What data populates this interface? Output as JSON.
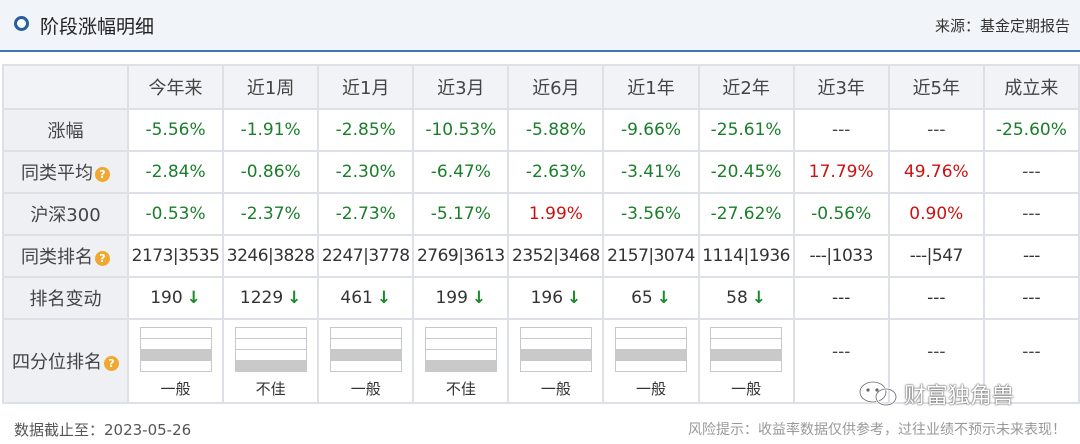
{
  "header": {
    "title": "阶段涨幅明细",
    "source": "来源：基金定期报告"
  },
  "table": {
    "columns": [
      "今年来",
      "近1周",
      "近1月",
      "近3月",
      "近6月",
      "近1年",
      "近2年",
      "近3年",
      "近5年",
      "成立来"
    ],
    "rows": {
      "change": {
        "label": "涨幅",
        "values": [
          "-5.56%",
          "-1.91%",
          "-2.85%",
          "-10.53%",
          "-5.88%",
          "-9.66%",
          "-25.61%",
          "---",
          "---",
          "-25.60%"
        ]
      },
      "peer_avg": {
        "label": "同类平均",
        "values": [
          "-2.84%",
          "-0.86%",
          "-2.30%",
          "-6.47%",
          "-2.63%",
          "-3.41%",
          "-20.45%",
          "17.79%",
          "49.76%",
          "---"
        ]
      },
      "hs300": {
        "label": "沪深300",
        "values": [
          "-0.53%",
          "-2.37%",
          "-2.73%",
          "-5.17%",
          "1.99%",
          "-3.56%",
          "-27.62%",
          "-0.56%",
          "0.90%",
          "---"
        ]
      },
      "peer_rank": {
        "label": "同类排名",
        "values": [
          "2173|3535",
          "3246|3828",
          "2247|3778",
          "2769|3613",
          "2352|3468",
          "2157|3074",
          "1114|1936",
          "---|1033",
          "---|547",
          "---"
        ]
      },
      "rank_change": {
        "label": "排名变动",
        "values": [
          "190",
          "1229",
          "461",
          "199",
          "196",
          "65",
          "58",
          "---",
          "---",
          "---"
        ],
        "arrow": "↓"
      },
      "quartile": {
        "label": "四分位排名",
        "labels": [
          "一般",
          "不佳",
          "一般",
          "不佳",
          "一般",
          "一般",
          "一般"
        ],
        "filled_quarter": [
          3,
          4,
          3,
          4,
          3,
          3,
          3
        ],
        "dashes": [
          "---",
          "---",
          "---"
        ]
      }
    },
    "help_icon": "?"
  },
  "footer": {
    "date": "数据截止至：2023-05-26",
    "risk": "风险提示：收益率数据仅供参考，过往业绩不预示未来表现！"
  },
  "watermark": "财富独角兽",
  "colors": {
    "positive": "#cc1111",
    "negative": "#1a7e2a",
    "accent": "#3f78b8"
  }
}
